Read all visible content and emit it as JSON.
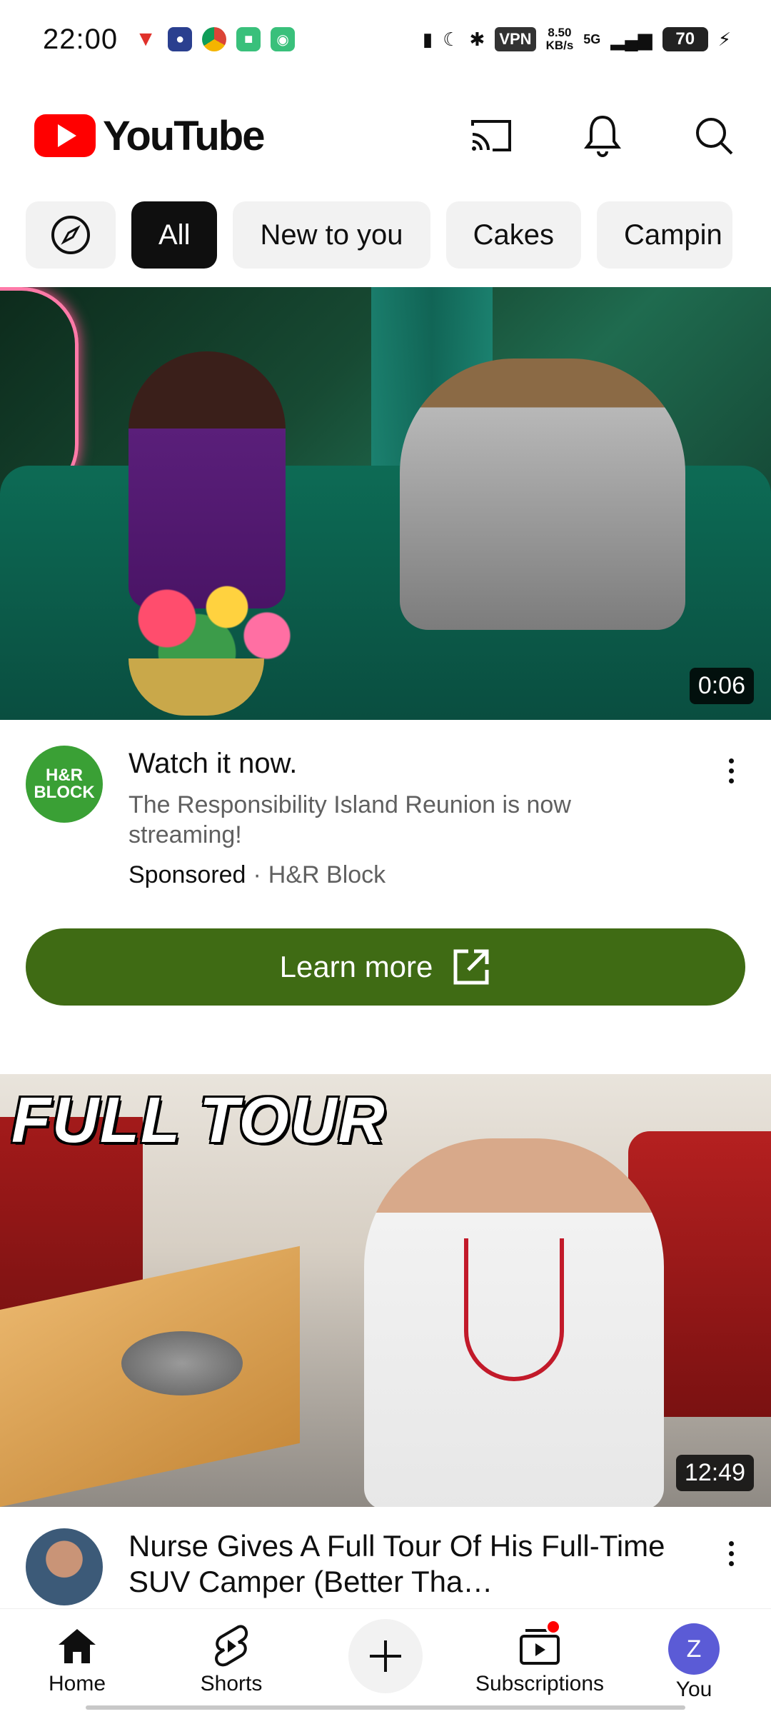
{
  "status_bar": {
    "time": "22:00",
    "vpn": "VPN",
    "net_speed_value": "8.50",
    "net_speed_unit": "KB/s",
    "network": "5G",
    "battery": "70"
  },
  "header": {
    "logo_text": "YouTube"
  },
  "chips": [
    {
      "label": "All",
      "active": true
    },
    {
      "label": "New to you"
    },
    {
      "label": "Cakes"
    },
    {
      "label": "Campin"
    }
  ],
  "ad": {
    "duration": "0:06",
    "avatar_text": "H&R BLOCK",
    "title": "Watch it now.",
    "description": "The Responsibility Island Reunion is now streaming!",
    "sponsored": "Sponsored",
    "separator": "·",
    "advertiser": "H&R Block",
    "cta": "Learn more"
  },
  "video2": {
    "overlay_text": "FULL TOUR",
    "duration": "12:49",
    "title": "Nurse Gives A Full Tour Of His Full-Time SUV Camper (Better Tha…"
  },
  "bottom_nav": {
    "home": "Home",
    "shorts": "Shorts",
    "subscriptions": "Subscriptions",
    "you": "You",
    "you_initial": "Z"
  },
  "colors": {
    "brand_red": "#ff0000",
    "cta_green": "#3f6b14",
    "chip_active": "#0f0f0f",
    "chip_bg": "#f2f2f2"
  }
}
